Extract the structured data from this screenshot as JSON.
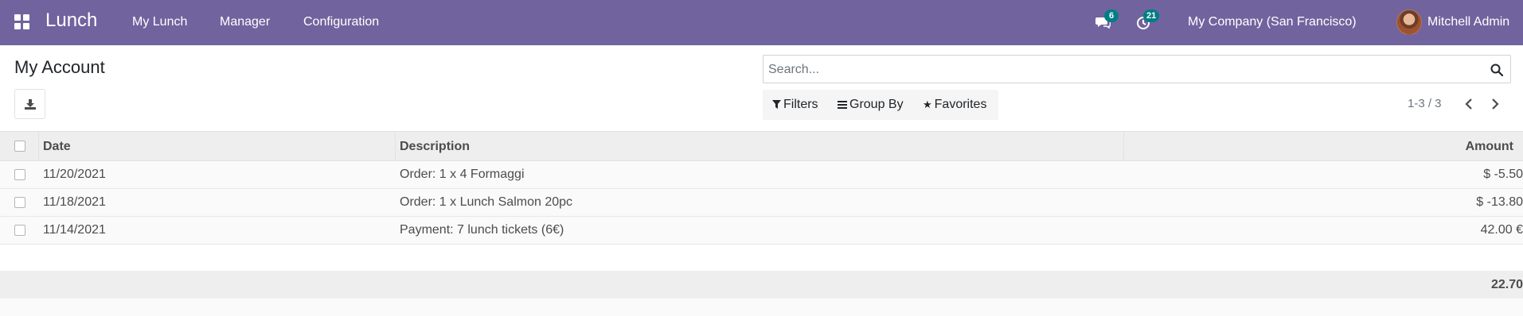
{
  "navbar": {
    "app_name": "Lunch",
    "menu": [
      "My Lunch",
      "Manager",
      "Configuration"
    ],
    "messages_badge": "6",
    "activities_badge": "21",
    "company": "My Company (San Francisco)",
    "user": "Mitchell Admin",
    "accent_color": "#71639e",
    "badge_color": "#017e84",
    "icons": [
      "apps-grid-icon",
      "chat-icon",
      "activity-clock-icon",
      "user-avatar"
    ]
  },
  "control_panel": {
    "title": "My Account",
    "search_placeholder": "Search...",
    "filters_label": "Filters",
    "groupby_label": "Group By",
    "favorites_label": "Favorites",
    "pager": "1-3 / 3",
    "icons": [
      "download-icon",
      "search-icon",
      "filter-icon",
      "group-by-icon",
      "star-icon",
      "chevron-left-icon",
      "chevron-right-icon"
    ]
  },
  "table": {
    "columns": [
      "Date",
      "Description",
      "Amount"
    ],
    "rows": [
      {
        "date": "11/20/2021",
        "description": "Order: 1 x 4 Formaggi",
        "amount": "$ -5.50"
      },
      {
        "date": "11/18/2021",
        "description": "Order: 1 x Lunch Salmon 20pc",
        "amount": "$ -13.80"
      },
      {
        "date": "11/14/2021",
        "description": "Payment: 7 lunch tickets (6€)",
        "amount": "42.00 €"
      }
    ],
    "total": "22.70"
  }
}
